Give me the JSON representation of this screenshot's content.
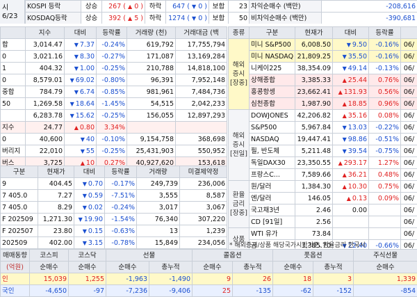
{
  "top_bar": {
    "sidebar_top": "시",
    "date": "6/23",
    "kospi": {
      "label": "KOSPI 등락",
      "up_label": "상승",
      "up": "267",
      "up_paren": "0",
      "down_label": "하락",
      "down": "647",
      "down_paren": "0",
      "flat_label": "보합",
      "flat": "23"
    },
    "kosdaq": {
      "label": "KOSDAQ등락",
      "up_label": "상승",
      "up": "392",
      "up_paren": "5",
      "down_label": "하락",
      "down": "1274",
      "down_paren": "0",
      "flat_label": "보합",
      "flat": "50"
    },
    "net1": {
      "label": "차익순매수 (백만)",
      "value": "-208,616"
    },
    "net2": {
      "label": "비차익순매수 (백만)",
      "value": "-390,681"
    }
  },
  "index_table": {
    "headers": [
      "",
      "지수",
      "대비",
      "등락률",
      "거래량 (천)",
      "거래대금 (백"
    ],
    "rows": [
      {
        "name": "합",
        "value": "3,014.47",
        "dir": "down",
        "chg": "7.37",
        "pct": "-0.24%",
        "vol": "619,792",
        "amt": "17,755,794"
      },
      {
        "name": "0",
        "value": "3,021.16",
        "dir": "down",
        "chg": "8.30",
        "pct": "-0.27%",
        "vol": "171,087",
        "amt": "13,169,284"
      },
      {
        "name": "1",
        "value": "404.32",
        "dir": "down",
        "chg": "1.00",
        "pct": "-0.25%",
        "vol": "210,788",
        "amt": "14,818,100"
      },
      {
        "name": "0",
        "value": "8,579.01",
        "dir": "down",
        "chg": "69.02",
        "pct": "-0.80%",
        "vol": "96,391",
        "amt": "7,952,148"
      },
      {
        "name": "중합",
        "value": "784.79",
        "dir": "down",
        "chg": "6.74",
        "pct": "-0.85%",
        "vol": "981,961",
        "amt": "7,484,736"
      },
      {
        "name": "50",
        "value": "1,269.58",
        "dir": "down",
        "chg": "18.64",
        "pct": "-1.45%",
        "vol": "54,515",
        "amt": "2,042,233"
      },
      {
        "name": "",
        "value": "6,283.78",
        "dir": "down",
        "chg": "15.62",
        "pct": "-0.25%",
        "vol": "156,055",
        "amt": "12,897,293"
      },
      {
        "name": "지수",
        "value": "24.77",
        "dir": "up",
        "chg": "0.80",
        "pct": "3.34%",
        "vol": "",
        "amt": ""
      },
      {
        "name": "0",
        "value": "40,600",
        "dir": "down",
        "chg": "40",
        "pct": "-0.10%",
        "vol": "9,154,758",
        "amt": "368,698"
      },
      {
        "name": "버리지",
        "value": "22,010",
        "dir": "down",
        "chg": "55",
        "pct": "-0.25%",
        "vol": "25,431,903",
        "amt": "550,952"
      },
      {
        "name": "버스",
        "value": "3,725",
        "dir": "up",
        "chg": "10",
        "pct": "0.27%",
        "vol": "40,927,620",
        "amt": "153,618"
      }
    ]
  },
  "futures_table": {
    "headers": [
      "구분",
      "현재가",
      "대비",
      "등락률",
      "거래량",
      "미결제약정"
    ],
    "rows": [
      {
        "name": "9",
        "value": "404.45",
        "dir": "down",
        "chg": "0.70",
        "pct": "-0.17%",
        "vol": "249,739",
        "oi": "236,006"
      },
      {
        "name": "7 405.0",
        "value": "7.27",
        "dir": "down",
        "chg": "0.59",
        "pct": "-7.51%",
        "vol": "3,555",
        "oi": "8,587"
      },
      {
        "name": "7 405.0",
        "value": "8.29",
        "dir": "down",
        "chg": "0.02",
        "pct": "-0.24%",
        "vol": "3,017",
        "oi": "3,067"
      },
      {
        "name": "F 202509",
        "value": "1,271.30",
        "dir": "down",
        "chg": "19.90",
        "pct": "-1.54%",
        "vol": "76,340",
        "oi": "307,220"
      },
      {
        "name": "F 202507",
        "value": "23.80",
        "dir": "down",
        "chg": "0.15",
        "pct": "-0.63%",
        "vol": "13",
        "oi": "1,239"
      },
      {
        "name": "202509",
        "value": "402.00",
        "dir": "down",
        "chg": "3.15",
        "pct": "-0.78%",
        "vol": "15,849",
        "oi": "234,056"
      }
    ]
  },
  "global_table": {
    "headers": [
      "종류",
      "구분",
      "현재가",
      "대비",
      "등락률",
      ""
    ],
    "groups": [
      {
        "label": "해외 증시 [장중]",
        "rows": [
          {
            "name": "미니 S&P500",
            "value": "6,008.50",
            "dir": "down",
            "chg": "9.50",
            "pct": "-0.16%",
            "d": "06/",
            "bg": "yel"
          },
          {
            "name": "미니 NASDAQ",
            "value": "21,809.25",
            "dir": "down",
            "chg": "35.50",
            "pct": "-0.16%",
            "d": "06/",
            "bg": "yel"
          },
          {
            "name": "니케이225",
            "value": "38,354.09",
            "dir": "down",
            "chg": "49.14",
            "pct": "-0.13%",
            "d": "06/",
            "bg": ""
          },
          {
            "name": "상해종합",
            "value": "3,385.33",
            "dir": "up",
            "chg": "25.44",
            "pct": "0.76%",
            "d": "06/",
            "bg": "pink"
          },
          {
            "name": "홍콩항셍",
            "value": "23,662.41",
            "dir": "up",
            "chg": "131.93",
            "pct": "0.56%",
            "d": "06/",
            "bg": "pink"
          },
          {
            "name": "심천종합",
            "value": "1,987.90",
            "dir": "up",
            "chg": "18.85",
            "pct": "0.96%",
            "d": "06/",
            "bg": "pink"
          }
        ]
      },
      {
        "label": "해외 증시 [전일]",
        "rows": [
          {
            "name": "DOWJONES",
            "value": "42,206.82",
            "dir": "up",
            "chg": "35.16",
            "pct": "0.08%",
            "d": "06/",
            "bg": ""
          },
          {
            "name": "S&P500",
            "value": "5,967.84",
            "dir": "down",
            "chg": "13.03",
            "pct": "-0.22%",
            "d": "06/",
            "bg": ""
          },
          {
            "name": "NASDAQ",
            "value": "19,447.41",
            "dir": "down",
            "chg": "98.86",
            "pct": "-0.51%",
            "d": "06/",
            "bg": ""
          },
          {
            "name": "필, 반도체",
            "value": "5,211.48",
            "dir": "down",
            "chg": "39.54",
            "pct": "-0.75%",
            "d": "06/",
            "bg": ""
          },
          {
            "name": "독일DAX30",
            "value": "23,350.55",
            "dir": "up",
            "chg": "293.17",
            "pct": "1.27%",
            "d": "06/",
            "bg": ""
          },
          {
            "name": "프랑스C...",
            "value": "7,589.66",
            "dir": "up",
            "chg": "36.21",
            "pct": "0.48%",
            "d": "06/",
            "bg": ""
          }
        ]
      },
      {
        "label": "환율 금리 [장중]",
        "rows": [
          {
            "name": "원/달러",
            "value": "1,384.30",
            "dir": "up",
            "chg": "10.30",
            "pct": "0.75%",
            "d": "06/",
            "bg": ""
          },
          {
            "name": "엔/달러",
            "value": "146.05",
            "dir": "up",
            "chg": "0.13",
            "pct": "0.09%",
            "d": "06/",
            "bg": ""
          },
          {
            "name": "국고채3년",
            "value": "2.46",
            "dir": "",
            "chg": "0.00",
            "pct": "",
            "d": "06/",
            "bg": ""
          },
          {
            "name": "CD [91일]",
            "value": "2.56",
            "dir": "",
            "chg": "",
            "pct": "",
            "d": "06/",
            "bg": ""
          }
        ]
      },
      {
        "label": "상품",
        "rows": [
          {
            "name": "WTI 유가",
            "value": "73.84",
            "dir": "",
            "chg": "",
            "pct": "",
            "d": "06/",
            "bg": ""
          },
          {
            "name": "금",
            "value": "3,385.70",
            "dir": "down",
            "chg": "22.40",
            "pct": "-0.66%",
            "d": "06/",
            "bg": ""
          }
        ]
      }
    ],
    "note": "* 해외증시/상품 해당국가시간기준, 환율금리 한국시"
  },
  "investor_table": {
    "title": "매매동향",
    "unit": "(억원)",
    "groups": [
      "코스피",
      "코스닥",
      "선물",
      "콜옵션",
      "풋옵션",
      "주식선물"
    ],
    "sub": {
      "net": "순매수",
      "cum": "총누적"
    },
    "rows": [
      {
        "name": "인",
        "vals": [
          "15,039",
          "1,255",
          "-1,963",
          "-1,490",
          "9",
          "26",
          "18",
          "3",
          "1,339"
        ]
      },
      {
        "name": "국인",
        "vals": [
          "-4,650",
          "-97",
          "-7,236",
          "-9,406",
          "25",
          "-135",
          "-62",
          "-152",
          "-854"
        ]
      }
    ]
  }
}
